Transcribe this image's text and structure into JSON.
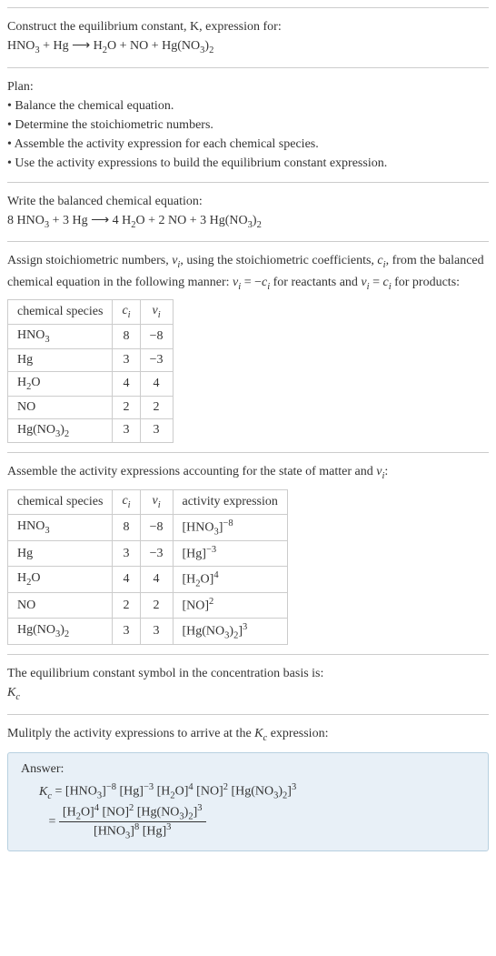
{
  "intro": {
    "construct": "Construct the equilibrium constant, K, expression for:",
    "equation": "HNO₃ + Hg ⟶ H₂O + NO + Hg(NO₃)₂"
  },
  "plan": {
    "heading": "Plan:",
    "items": [
      "• Balance the chemical equation.",
      "• Determine the stoichiometric numbers.",
      "• Assemble the activity expression for each chemical species.",
      "• Use the activity expressions to build the equilibrium constant expression."
    ]
  },
  "balanced": {
    "heading": "Write the balanced chemical equation:",
    "equation": "8 HNO₃ + 3 Hg ⟶ 4 H₂O + 2 NO + 3 Hg(NO₃)₂"
  },
  "assign": {
    "text1": "Assign stoichiometric numbers, νᵢ, using the stoichiometric coefficients, cᵢ, from the balanced chemical equation in the following manner: νᵢ = −cᵢ for reactants and νᵢ = cᵢ for products:",
    "headers": [
      "chemical species",
      "cᵢ",
      "νᵢ"
    ],
    "rows": [
      [
        "HNO₃",
        "8",
        "−8"
      ],
      [
        "Hg",
        "3",
        "−3"
      ],
      [
        "H₂O",
        "4",
        "4"
      ],
      [
        "NO",
        "2",
        "2"
      ],
      [
        "Hg(NO₃)₂",
        "3",
        "3"
      ]
    ]
  },
  "activity": {
    "heading": "Assemble the activity expressions accounting for the state of matter and νᵢ:",
    "headers": [
      "chemical species",
      "cᵢ",
      "νᵢ",
      "activity expression"
    ],
    "rows": [
      [
        "HNO₃",
        "8",
        "−8",
        "[HNO₃]⁻⁸"
      ],
      [
        "Hg",
        "3",
        "−3",
        "[Hg]⁻³"
      ],
      [
        "H₂O",
        "4",
        "4",
        "[H₂O]⁴"
      ],
      [
        "NO",
        "2",
        "2",
        "[NO]²"
      ],
      [
        "Hg(NO₃)₂",
        "3",
        "3",
        "[Hg(NO₃)₂]³"
      ]
    ]
  },
  "symbol": {
    "text": "The equilibrium constant symbol in the concentration basis is:",
    "kc": "K𝒸"
  },
  "multiply": {
    "text": "Mulitply the activity expressions to arrive at the K𝒸 expression:"
  },
  "answer": {
    "label": "Answer:",
    "line1": "K𝒸 = [HNO₃]⁻⁸ [Hg]⁻³ [H₂O]⁴ [NO]² [Hg(NO₃)₂]³",
    "eq": "=",
    "num": "[H₂O]⁴ [NO]² [Hg(NO₃)₂]³",
    "den": "[HNO₃]⁸ [Hg]³"
  },
  "chart_data": {
    "type": "table",
    "tables": [
      {
        "title": "Stoichiometric numbers",
        "headers": [
          "chemical species",
          "c_i",
          "nu_i"
        ],
        "rows": [
          {
            "species": "HNO3",
            "c_i": 8,
            "nu_i": -8
          },
          {
            "species": "Hg",
            "c_i": 3,
            "nu_i": -3
          },
          {
            "species": "H2O",
            "c_i": 4,
            "nu_i": 4
          },
          {
            "species": "NO",
            "c_i": 2,
            "nu_i": 2
          },
          {
            "species": "Hg(NO3)2",
            "c_i": 3,
            "nu_i": 3
          }
        ]
      },
      {
        "title": "Activity expressions",
        "headers": [
          "chemical species",
          "c_i",
          "nu_i",
          "activity expression"
        ],
        "rows": [
          {
            "species": "HNO3",
            "c_i": 8,
            "nu_i": -8,
            "activity": "[HNO3]^-8"
          },
          {
            "species": "Hg",
            "c_i": 3,
            "nu_i": -3,
            "activity": "[Hg]^-3"
          },
          {
            "species": "H2O",
            "c_i": 4,
            "nu_i": 4,
            "activity": "[H2O]^4"
          },
          {
            "species": "NO",
            "c_i": 2,
            "nu_i": 2,
            "activity": "[NO]^2"
          },
          {
            "species": "Hg(NO3)2",
            "c_i": 3,
            "nu_i": 3,
            "activity": "[Hg(NO3)2]^3"
          }
        ]
      }
    ],
    "equilibrium_constant": "Kc = ([H2O]^4 [NO]^2 [Hg(NO3)2]^3) / ([HNO3]^8 [Hg]^3)"
  }
}
